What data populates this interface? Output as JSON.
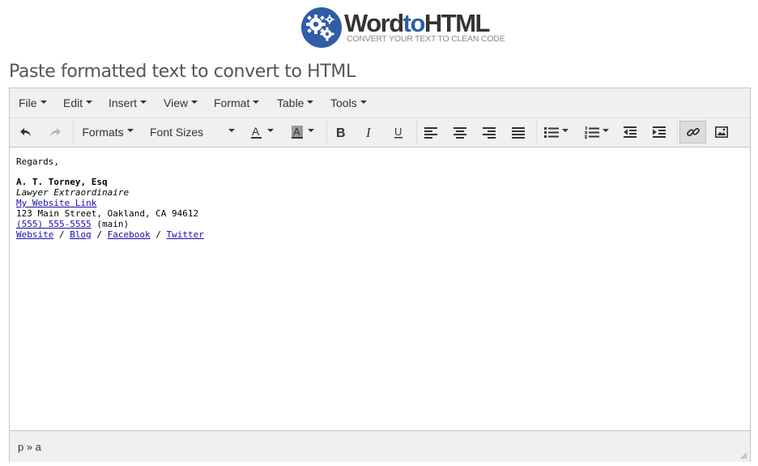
{
  "logo": {
    "word_part1": "Word",
    "word_part2": "to",
    "word_part3": "HTML",
    "tagline": "CONVERT YOUR TEXT TO CLEAN CODE",
    "brand_color": "#2f5da8"
  },
  "heading": "Paste formatted text to convert to HTML",
  "menubar": {
    "items": [
      "File",
      "Edit",
      "Insert",
      "View",
      "Format",
      "Table",
      "Tools"
    ]
  },
  "toolbar": {
    "formats_label": "Formats",
    "font_sizes_label": "Font Sizes",
    "icons": [
      "undo-icon",
      "redo-icon",
      "font-color-icon",
      "background-color-icon",
      "bold-icon",
      "italic-icon",
      "underline-icon",
      "align-left-icon",
      "align-center-icon",
      "align-right-icon",
      "align-justify-icon",
      "bullet-list-icon",
      "numbered-list-icon",
      "outdent-icon",
      "indent-icon",
      "link-icon",
      "image-icon"
    ]
  },
  "content": {
    "greeting": "Regards,",
    "name": "A. T. Torney, Esq",
    "title": "Lawyer Extraordinaire",
    "website_link": "My Website Link",
    "address": "123 Main Street, Oakland, CA 94612",
    "phone": "(555) 555-5555",
    "phone_suffix": " (main)",
    "links": [
      "Website",
      "Blog",
      "Facebook",
      "Twitter"
    ],
    "separator": " / "
  },
  "statusbar": {
    "path": "p » a"
  }
}
